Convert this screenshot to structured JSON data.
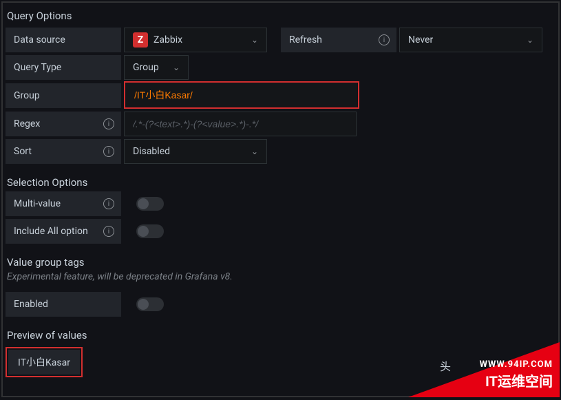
{
  "sections": {
    "query_options": "Query Options",
    "selection_options": "Selection Options",
    "value_group_tags": "Value group tags",
    "value_group_tags_sub": "Experimental feature, will be deprecated in Grafana v8.",
    "preview_values": "Preview of values"
  },
  "labels": {
    "data_source": "Data source",
    "refresh": "Refresh",
    "query_type": "Query Type",
    "group": "Group",
    "regex": "Regex",
    "sort": "Sort",
    "multi_value": "Multi-value",
    "include_all": "Include All option",
    "enabled": "Enabled"
  },
  "values": {
    "data_source": "Zabbix",
    "refresh_select": "Never",
    "query_type": "Group",
    "group_input": "/IT小白Kasar/",
    "regex_placeholder": "/.*-(?<text>.*)-(?<value>.*)-.*/",
    "sort_select": "Disabled",
    "preview_item": "IT小白Kasar",
    "multi_value": false,
    "include_all": false,
    "enabled": false
  },
  "icons": {
    "z": "Z"
  },
  "watermark": {
    "url": "WWW.94IP.COM",
    "cn": "IT运维空间",
    "tou": "头"
  }
}
